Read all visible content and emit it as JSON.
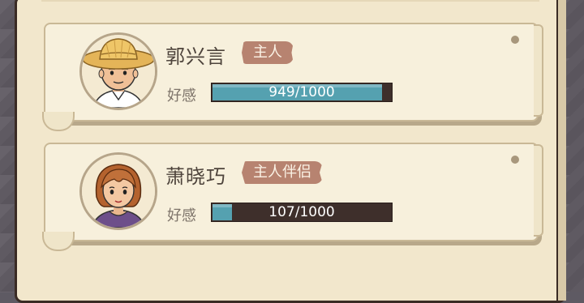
{
  "characters": [
    {
      "name": "郭兴言",
      "tag": "主人",
      "affinity_label": "好感",
      "affinity_text": "949/1000",
      "affinity_fraction": 0.949
    },
    {
      "name": "萧晓巧",
      "tag": "主人伴侣",
      "affinity_label": "好感",
      "affinity_text": "107/1000",
      "affinity_fraction": 0.107
    }
  ],
  "colors": {
    "bar_fill": "#55a1b0",
    "bar_bg": "#3e2f2b",
    "tag_bg": "#b78370"
  }
}
